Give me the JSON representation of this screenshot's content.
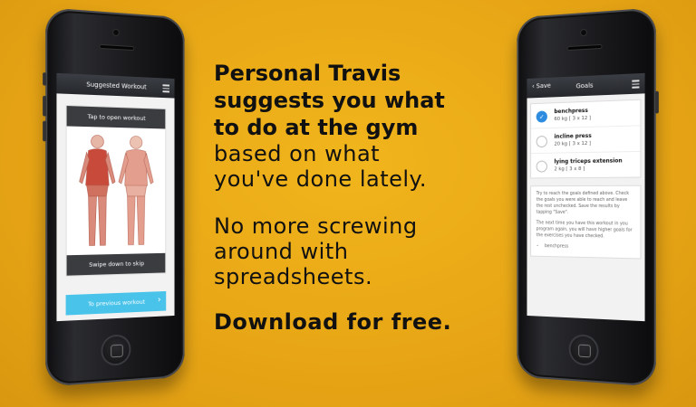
{
  "left_phone": {
    "title": "Suggested Workout",
    "card_top": "Tap to open workout",
    "card_bottom": "Swipe down to skip",
    "prev_button": "To previous workout",
    "chevron": "›"
  },
  "right_phone": {
    "back_label": "Save",
    "back_icon": "‹",
    "title": "Goals",
    "goals": [
      {
        "name": "benchpress",
        "detail": "60 kg [ 3 x 12 ]",
        "checked": true
      },
      {
        "name": "incline press",
        "detail": "20 kg [ 3 x 12 ]",
        "checked": false
      },
      {
        "name": "lying triceps extension",
        "detail": "2 kg [ 3 x 8 ]",
        "checked": false
      }
    ],
    "info_p1": "Try to reach the goals defined above. Check the goals you were able to reach and leave the rest unchecked. Save the results by tapping \"Save\".",
    "info_p2": "The next time you have this workout in you program again, you will have higher goals for the exercises you have checked.",
    "info_list": [
      "benchpress"
    ]
  },
  "copy": {
    "bold_lines": [
      "Personal Travis",
      "suggests you what",
      "to do at the gym"
    ],
    "light_lines": [
      "based on what",
      "you've done lately."
    ],
    "para2": [
      "No more screwing",
      "around with",
      "spreadsheets."
    ],
    "cta": "Download for free."
  },
  "colors": {
    "background": "#e9a817",
    "accent_blue": "#49c3ea",
    "check_blue": "#2d8ce0"
  },
  "icons": [
    "menu-icon",
    "chevron-right-icon",
    "chevron-left-icon",
    "check-icon",
    "home-button-icon"
  ]
}
